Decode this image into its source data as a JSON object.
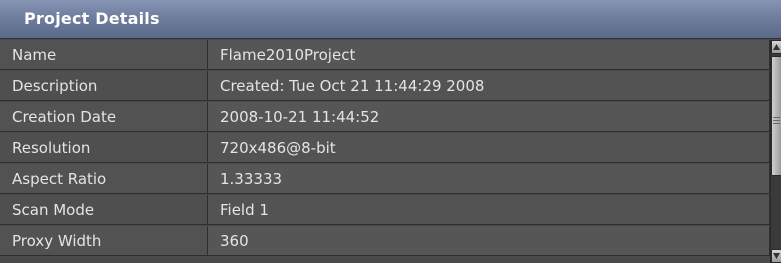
{
  "header": {
    "title": "Project Details"
  },
  "rows": [
    {
      "name": "Name",
      "value": "Flame2010Project"
    },
    {
      "name": "Description",
      "value": "Created: Tue Oct 21 11:44:29 2008"
    },
    {
      "name": "Creation Date",
      "value": "2008-10-21 11:44:52"
    },
    {
      "name": "Resolution",
      "value": "720x486@8-bit"
    },
    {
      "name": "Aspect Ratio",
      "value": "1.33333"
    },
    {
      "name": "Scan Mode",
      "value": "Field 1"
    },
    {
      "name": "Proxy Width",
      "value": "360"
    }
  ],
  "colors": {
    "header_bar": "#6f7d9e",
    "row_background": "#525252",
    "text": "#e4e4e4"
  },
  "icons": {
    "scroll_up": "scroll-up-arrow-icon",
    "scroll_down": "scroll-down-arrow-icon",
    "thumb_grip": "grip-icon"
  }
}
